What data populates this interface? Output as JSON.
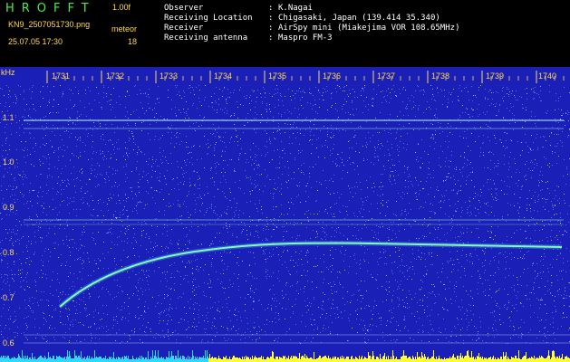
{
  "header": {
    "app_name": "HROFFT",
    "version": "1.00f",
    "file_name": "KN9_2507051730.png",
    "meteor_label": "meteor",
    "timestamp": "25.07.05 17:30",
    "meteor_count": "18"
  },
  "info": [
    {
      "key": "Observer",
      "value": "K.Nagai"
    },
    {
      "key": "Receiving Location",
      "value": "Chigasaki, Japan (139.414 35.340)"
    },
    {
      "key": "Receiver",
      "value": "AirSpy mini (Miakejima VOR 108.65MHz)"
    },
    {
      "key": "Receiving antenna",
      "value": "Maspro FM-3"
    }
  ],
  "spectrogram": {
    "y_unit": "kHz",
    "y_ticks": [
      "1.1",
      "1.0",
      "0.9",
      "0.8",
      "0.7",
      "0.6"
    ],
    "time_ticks": [
      "1731",
      "1732",
      "1733",
      "1734",
      "1735",
      "1736",
      "1737",
      "1738",
      "1739",
      "1740"
    ],
    "colors": {
      "background": "#1a1fb8",
      "noise_light": "#7fa8ff",
      "echo": "#7dffb0",
      "carrier": "#9fe8d8",
      "time_mark": "#ffd94a",
      "bar_left": "#2fd8ff",
      "bar_right": "#ffff33"
    }
  }
}
